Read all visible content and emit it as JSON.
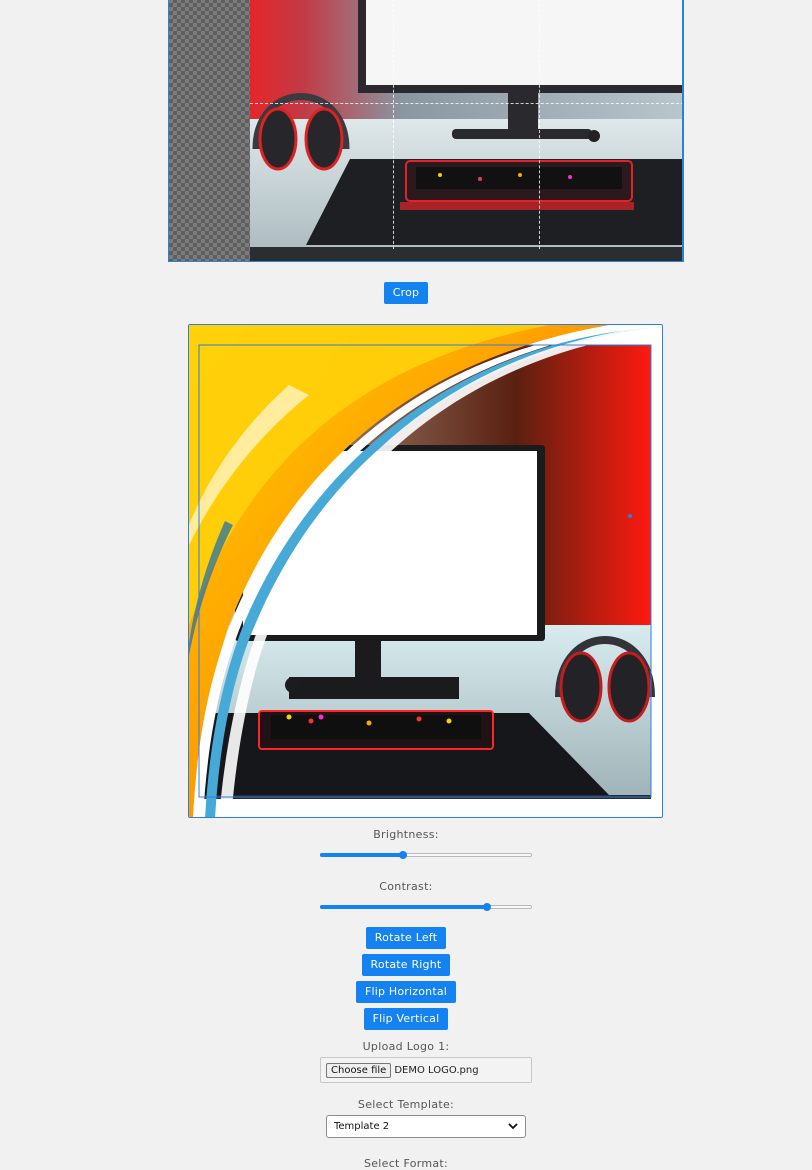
{
  "cropper": {
    "crop_button": "Crop"
  },
  "controls": {
    "brightness_label": "Brightness:",
    "brightness_value": 0.39,
    "contrast_label": "Contrast:",
    "contrast_value": 0.79,
    "rotate_left": "Rotate Left",
    "rotate_right": "Rotate Right",
    "flip_horizontal": "Flip Horizontal",
    "flip_vertical": "Flip Vertical",
    "upload_logo_label": "Upload Logo 1:",
    "choose_file": "Choose file",
    "file_name": "DEMO LOGO.png",
    "template_label": "Select Template:",
    "template_value": "Template 2",
    "format_label": "Select Format:"
  },
  "colors": {
    "accent": "#1482f0",
    "background": "#f1f1f1"
  },
  "icons": [
    "checkerboard-transparency-icon",
    "chevron-down-icon"
  ]
}
